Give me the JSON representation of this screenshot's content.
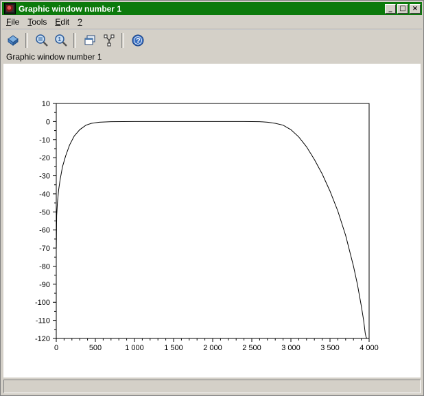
{
  "window": {
    "title": "Graphic window number 1",
    "controls": {
      "minimize": "_",
      "maximize": "□",
      "close": "×"
    }
  },
  "menu": {
    "items": [
      {
        "label": "File",
        "underline": "F",
        "rest": "ile"
      },
      {
        "label": "Tools",
        "underline": "T",
        "rest": "ools"
      },
      {
        "label": "Edit",
        "underline": "E",
        "rest": "dit"
      },
      {
        "label": "?",
        "underline": "?",
        "rest": ""
      }
    ]
  },
  "toolbar": {
    "buttons": [
      {
        "name": "rotate-icon"
      },
      {
        "name": "zoom-icon"
      },
      {
        "name": "unzoom-icon"
      },
      {
        "name": "axes-icon"
      },
      {
        "name": "datatip-icon"
      },
      {
        "name": "help-icon"
      }
    ]
  },
  "figure_label": "Graphic window number 1",
  "chart_data": {
    "type": "line",
    "title": "",
    "xlabel": "",
    "ylabel": "",
    "xlim": [
      0,
      4000
    ],
    "ylim": [
      -120,
      10
    ],
    "x_ticks": [
      "0",
      "500",
      "1 000",
      "1 500",
      "2 000",
      "2 500",
      "3 000",
      "3 500",
      "4 000"
    ],
    "y_ticks": [
      "10",
      "0",
      "-10",
      "-20",
      "-30",
      "-40",
      "-50",
      "-60",
      "-70",
      "-80",
      "-90",
      "-100",
      "-110",
      "-120"
    ],
    "grid": false,
    "series": [
      {
        "color": "#000000",
        "x": [
          1,
          5,
          15,
          30,
          50,
          80,
          120,
          170,
          230,
          300,
          380,
          450,
          550,
          700,
          1000,
          1500,
          2000,
          2400,
          2600,
          2700,
          2800,
          2900,
          3000,
          3100,
          3200,
          3300,
          3400,
          3500,
          3600,
          3700,
          3800,
          3850,
          3900,
          3930,
          3950,
          3960,
          3970
        ],
        "y": [
          -70,
          -52,
          -45,
          -38,
          -32,
          -25,
          -19,
          -13,
          -8,
          -4.5,
          -2,
          -1,
          -0.4,
          -0.1,
          0,
          0,
          0,
          0,
          -0.1,
          -0.4,
          -1,
          -2,
          -4.5,
          -8.5,
          -14,
          -21,
          -29,
          -38.5,
          -49.5,
          -63,
          -80,
          -90,
          -102,
          -110,
          -117,
          -119,
          -120
        ]
      }
    ]
  }
}
